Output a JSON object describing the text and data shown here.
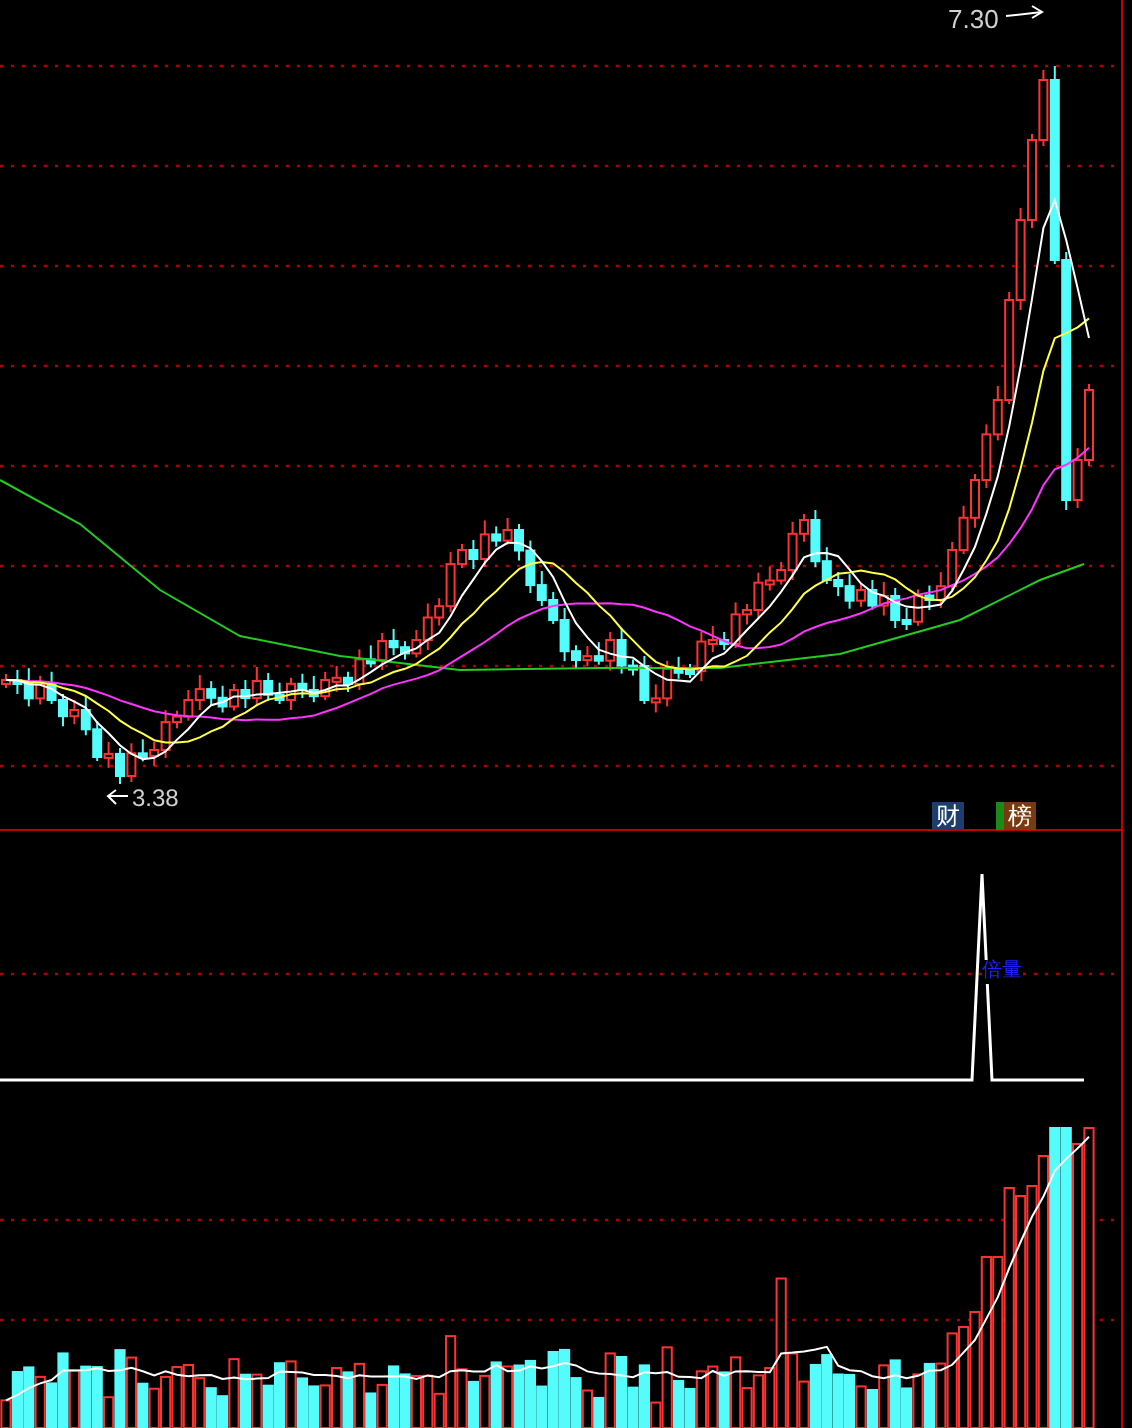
{
  "price_chart": {
    "high_label": "7.30",
    "low_label": "3.38"
  },
  "badges": [
    {
      "text": "财",
      "kind": "finance"
    },
    {
      "text": "榜",
      "kind": "ranking"
    }
  ],
  "indicator": {
    "signal_label": "倍量"
  }
}
